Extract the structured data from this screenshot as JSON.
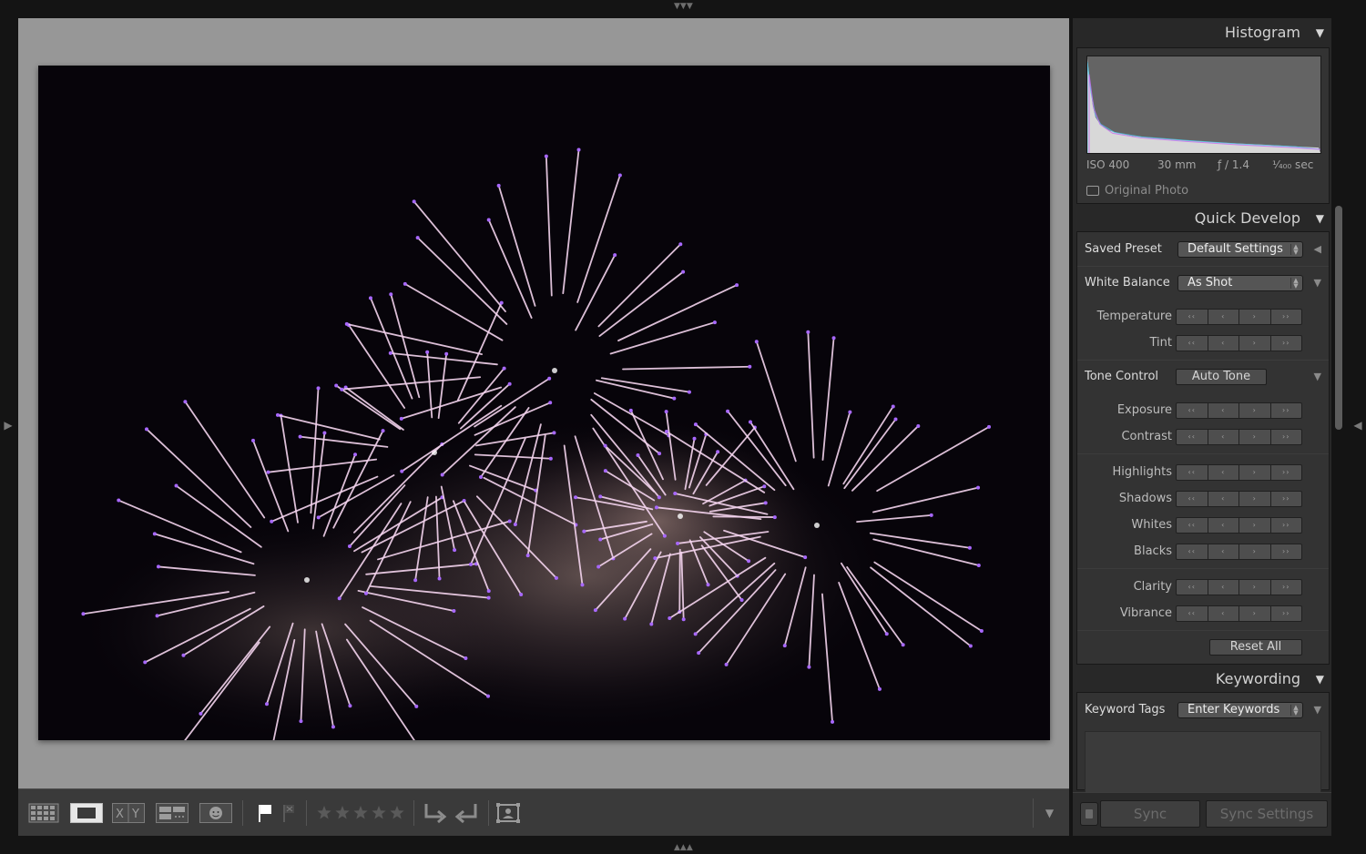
{
  "histogram": {
    "title": "Histogram",
    "iso": "ISO 400",
    "focal": "30 mm",
    "aperture": "ƒ / 1.4",
    "shutter": "¹⁄₄₀₀ sec",
    "original_photo": "Original Photo"
  },
  "quick_develop": {
    "title": "Quick Develop",
    "saved_preset_label": "Saved Preset",
    "saved_preset_value": "Default Settings",
    "white_balance_label": "White Balance",
    "white_balance_value": "As Shot",
    "temperature": "Temperature",
    "tint": "Tint",
    "tone_control_label": "Tone Control",
    "auto_tone": "Auto Tone",
    "exposure": "Exposure",
    "contrast": "Contrast",
    "highlights": "Highlights",
    "shadows": "Shadows",
    "whites": "Whites",
    "blacks": "Blacks",
    "clarity": "Clarity",
    "vibrance": "Vibrance",
    "reset_all": "Reset All",
    "stepper_glyphs": [
      "‹‹",
      "‹",
      "›",
      "››"
    ]
  },
  "keywording": {
    "title": "Keywording",
    "keyword_tags_label": "Keyword Tags",
    "keyword_tags_value": "Enter Keywords"
  },
  "sync": {
    "sync": "Sync",
    "sync_settings": "Sync Settings"
  },
  "toolbar": {
    "view_modes": [
      "grid-view-icon",
      "loupe-view-icon",
      "compare-view-icon",
      "survey-view-icon",
      "people-view-icon"
    ],
    "compare_label": "X Y",
    "rating_stars": 0,
    "icons": [
      "flag-pick-icon",
      "flag-reject-icon",
      "rotate-left-icon",
      "rotate-right-icon",
      "crop-overlay-icon"
    ]
  },
  "colors": {
    "viewer_bg": "#979797",
    "panel_bg": "#282828",
    "panel_box": "#333333",
    "firework_pink": "#f4d4ee",
    "firework_violet": "#a868ff"
  }
}
